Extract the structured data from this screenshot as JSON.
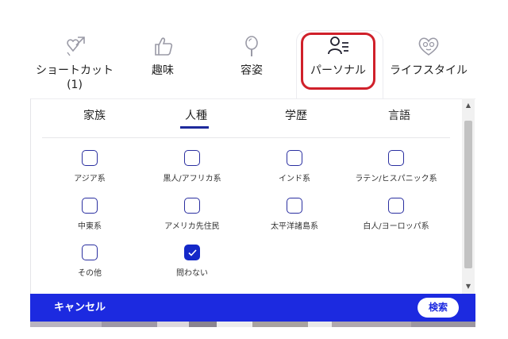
{
  "categories": [
    {
      "label": "ショートカット",
      "count": "(1)",
      "icon": "sparkle-heart-icon"
    },
    {
      "label": "趣味",
      "icon": "thumbs-up-icon"
    },
    {
      "label": "容姿",
      "icon": "hand-mirror-icon"
    },
    {
      "label": "パーソナル",
      "icon": "person-list-icon"
    },
    {
      "label": "ライフスタイル",
      "icon": "heart-face-icon"
    }
  ],
  "subtabs": [
    "家族",
    "人種",
    "学歴",
    "言語"
  ],
  "active_subtab": "人種",
  "options": [
    {
      "label": "アジア系",
      "checked": false
    },
    {
      "label": "黒人/アフリカ系",
      "checked": false
    },
    {
      "label": "インド系",
      "checked": false
    },
    {
      "label": "ラテン/ヒスパニック系",
      "checked": false
    },
    {
      "label": "中東系",
      "checked": false
    },
    {
      "label": "アメリカ先住民",
      "checked": false
    },
    {
      "label": "太平洋諸島系",
      "checked": false
    },
    {
      "label": "白人/ヨーロッパ系",
      "checked": false
    },
    {
      "label": "その他",
      "checked": false
    },
    {
      "label": "問わない",
      "checked": true
    }
  ],
  "footer": {
    "cancel_label": "キャンセル",
    "search_label": "検索"
  },
  "colors": {
    "accent": "#1c2ae0",
    "checked": "#1428c8",
    "highlight": "#d0202a",
    "underline": "#1e2a9c"
  }
}
